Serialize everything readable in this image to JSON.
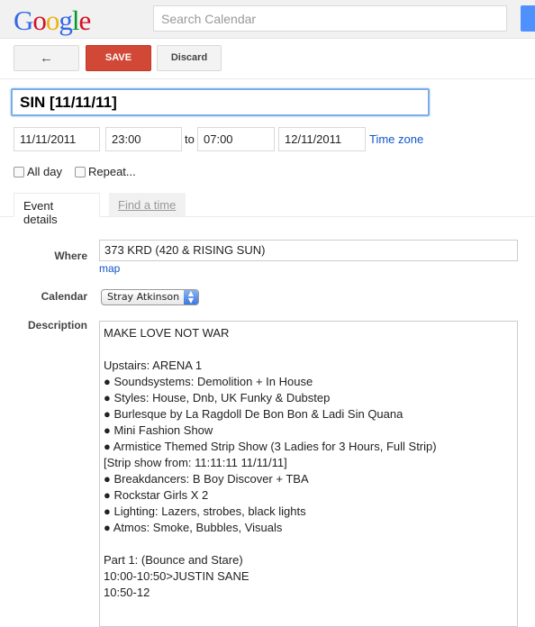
{
  "header": {
    "logo": "Google",
    "search_placeholder": "Search Calendar"
  },
  "toolbar": {
    "back_icon": "←",
    "save_label": "SAVE",
    "discard_label": "Discard"
  },
  "event": {
    "title": "SIN [11/11/11]",
    "start_date": "11/11/2011",
    "start_time": "23:00",
    "to": "to",
    "end_time": "07:00",
    "end_date": "12/11/2011",
    "time_zone_link": "Time zone",
    "all_day_label": "All day",
    "repeat_label": "Repeat..."
  },
  "tabs": [
    {
      "label": "Event details",
      "active": true
    },
    {
      "label": "Find a time",
      "active": false
    }
  ],
  "details": {
    "where_label": "Where",
    "where_value": "373 KRD (420 & RISING SUN)",
    "map_link": "map",
    "calendar_label": "Calendar",
    "calendar_value": "Stray Atkinson",
    "description_label": "Description",
    "description_lines": [
      "MAKE LOVE NOT WAR",
      "",
      "Upstairs: ARENA 1",
      "● Soundsystems: Demolition + In House",
      "● Styles: House, Dnb, UK Funky & Dubstep",
      "● Burlesque by La Ragdoll De Bon Bon & Ladi Sin Quana",
      "● Mini Fashion Show",
      "● Armistice Themed Strip Show (3 Ladies for 3 Hours, Full Strip)",
      "[Strip show from: 11:11:11 11/11/11]",
      "● Breakdancers: B Boy Discover + TBA",
      "● Rockstar Girls X 2",
      "● Lighting: Lazers, strobes, black lights",
      "● Atmos: Smoke, Bubbles, Visuals",
      "",
      "Part 1: (Bounce and Stare)",
      "10:00-10:50>JUSTIN SANE",
      "10:50-12"
    ]
  },
  "colors": {
    "save": "#d14836",
    "link": "#1155cc",
    "focus": "#7baee8"
  }
}
